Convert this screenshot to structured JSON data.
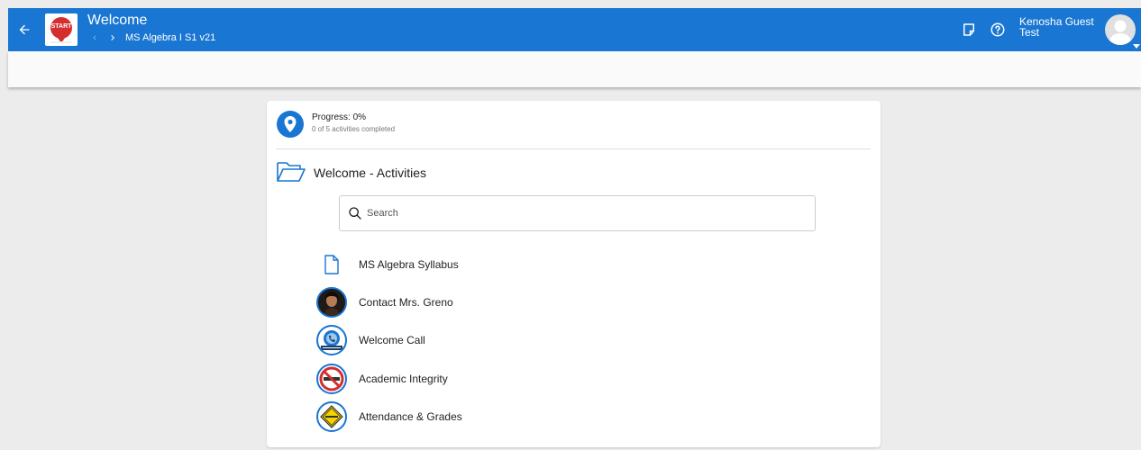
{
  "header": {
    "title": "Welcome",
    "course": "MS Algebra I S1 v21",
    "user_first": "Kenosha Guest",
    "user_last": "Test",
    "logo_text": "START",
    "colors": {
      "primary": "#1976d2",
      "logo_red": "#d32f2f"
    },
    "icons": [
      "arrow-back-icon",
      "chevron-left-icon",
      "chevron-right-icon",
      "note-icon",
      "help-icon",
      "user-avatar-icon",
      "caret-down-icon"
    ]
  },
  "progress": {
    "title": "Progress: 0%",
    "percent": 0,
    "subtitle": "0 of 5 activities completed"
  },
  "folder": {
    "title": "Welcome - Activities"
  },
  "search": {
    "placeholder": "Search"
  },
  "activities": [
    {
      "label": "MS Algebra Syllabus",
      "icon": "document-icon"
    },
    {
      "label": "Contact Mrs. Greno",
      "icon": "teacher-photo-icon"
    },
    {
      "label": "Welcome Call",
      "icon": "phone-badge-icon"
    },
    {
      "label": "Academic Integrity",
      "icon": "no-plagiarism-icon"
    },
    {
      "label": "Attendance & Grades",
      "icon": "attendance-sign-icon"
    }
  ]
}
